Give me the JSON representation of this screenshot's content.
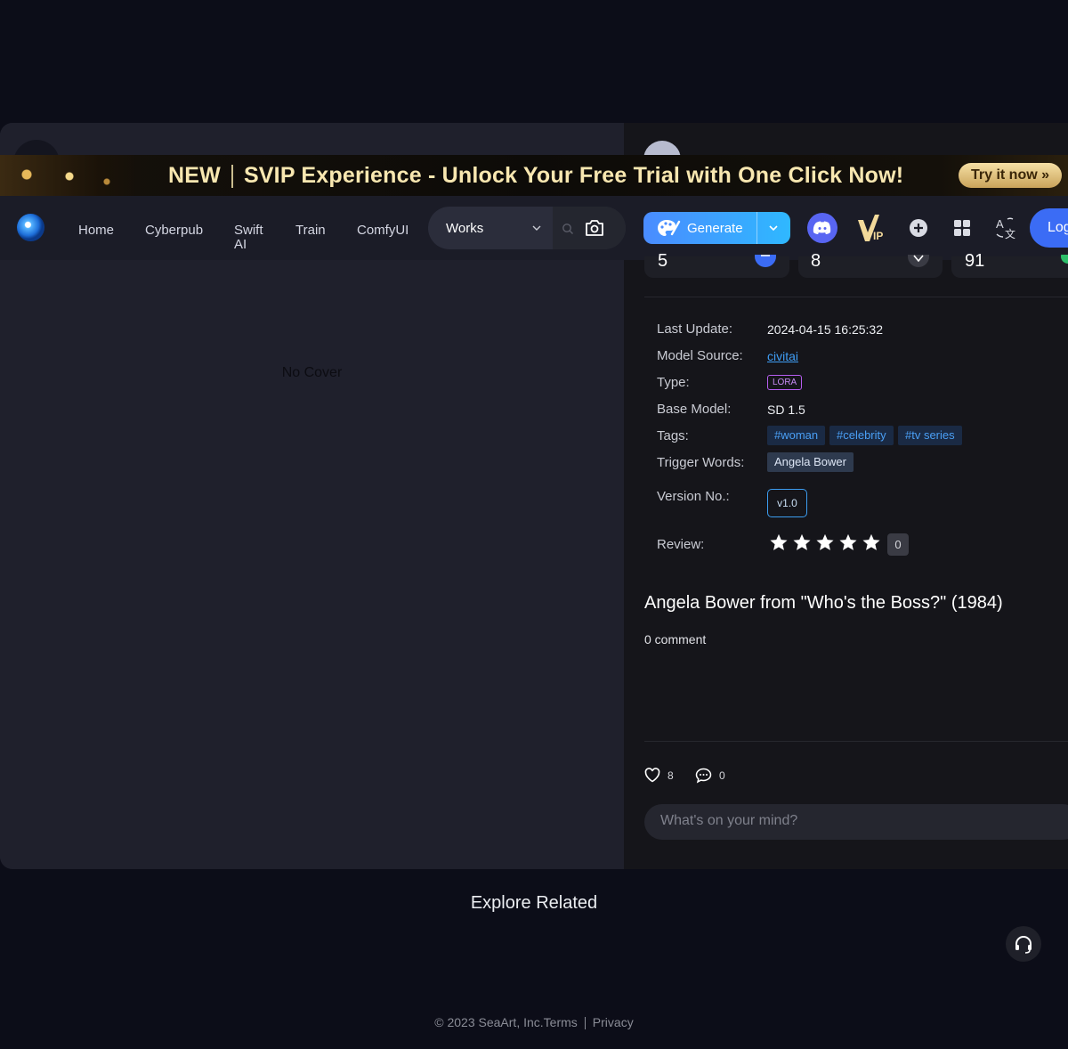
{
  "banner": {
    "new_label": "NEW",
    "text": "SVIP Experience - Unlock Your Free Trial with One Click Now!",
    "cta": "Try it now »"
  },
  "nav": {
    "items": [
      "Home",
      "Cyberpub",
      "Swift AI",
      "Train",
      "ComfyUI"
    ],
    "works_select": "Works",
    "generate_label": "Generate",
    "login_label": "Log"
  },
  "left_pane": {
    "no_cover": "No Cover"
  },
  "stats": [
    "5",
    "8",
    "91"
  ],
  "details": {
    "last_update_label": "Last Update:",
    "last_update": "2024-04-15 16:25:32",
    "model_source_label": "Model Source:",
    "model_source": "civitai",
    "type_label": "Type:",
    "type": "LORA",
    "base_model_label": "Base Model:",
    "base_model": "SD 1.5",
    "tags_label": "Tags:",
    "tags": [
      "#woman",
      "#celebrity",
      "#tv series"
    ],
    "trigger_label": "Trigger Words:",
    "trigger": "Angela Bower",
    "version_label": "Version No.:",
    "version": "v1.0",
    "review_label": "Review:",
    "review_count": "0",
    "rating_stars": 5
  },
  "post": {
    "title": "Angela Bower from \"Who's the Boss?\" (1984)",
    "comment_count": "0 comment",
    "likes": "8",
    "comments": "0",
    "input_placeholder": "What's on your mind?"
  },
  "explore_label": "Explore Related",
  "footer": {
    "copyright": "© 2023 SeaArt, Inc.",
    "terms": "Terms",
    "privacy": "Privacy"
  },
  "colors": {
    "accent": "#3b6cf5",
    "tag_text": "#4a9ff5",
    "banner_text": "#f8e7b0"
  }
}
